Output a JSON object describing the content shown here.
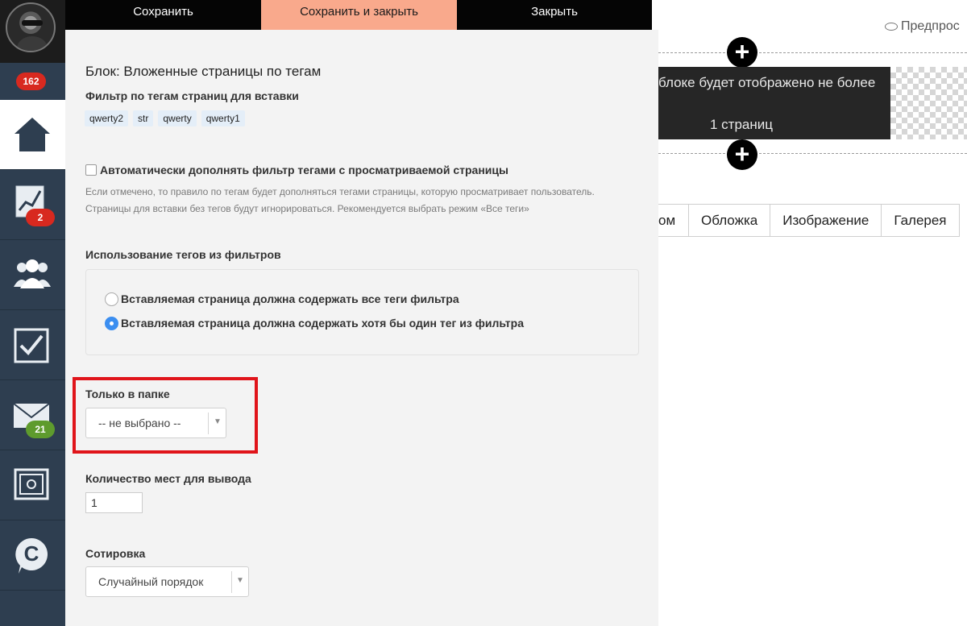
{
  "nav": {
    "badge_top": "162",
    "items": [
      {
        "name": "home",
        "badge": ""
      },
      {
        "name": "stats",
        "badge": "2"
      },
      {
        "name": "users",
        "badge": ""
      },
      {
        "name": "tasks",
        "badge": ""
      },
      {
        "name": "mail",
        "badge": "21"
      },
      {
        "name": "safe",
        "badge": ""
      },
      {
        "name": "support",
        "badge": ""
      }
    ]
  },
  "toolbar": {
    "save_label": "Сохранить",
    "save_close_label": "Сохранить и закрыть",
    "close_label": "Закрыть"
  },
  "form": {
    "title": "Блок: Вложенные страницы по тегам",
    "filter_label": "Фильтр по тегам страниц для вставки",
    "tags": [
      "qwerty2",
      "str",
      "qwerty",
      "qwerty1"
    ],
    "auto_fill_label": "Автоматически дополнять фильтр тегами с просматриваемой страницы",
    "auto_fill_help_1": "Если отмечено, то правило по тегам будет дополняться тегами страницы, которую просматривает пользователь.",
    "auto_fill_help_2": "Страницы для вставки без тегов будут игнорироваться. Рекомендуется выбрать режим «Все теги»",
    "tags_usage_label": "Использование тегов из фильтров",
    "radio_all": "Вставляемая страница должна содержать все теги фильтра",
    "radio_any": "Вставляемая страница должна содержать хотя бы один тег из фильтра",
    "folder_label": "Только в папке",
    "folder_value": "-- не выбрано --",
    "count_label": "Количество мест для вывода",
    "count_value": "1",
    "sort_label": "Сотировка",
    "sort_value": "Случайный порядок"
  },
  "preview": {
    "preview_label": "Предпрос",
    "block_text_line1": "блоке будет отображено не более",
    "block_text_line2": "1 страниц",
    "tabs": [
      "ом",
      "Обложка",
      "Изображение",
      "Галерея"
    ]
  },
  "colors": {
    "accent_button": "#f9a98c",
    "nav_bg": "#2e3e50",
    "highlight": "#e0141a",
    "badge_red": "#d8291f",
    "badge_green": "#5e9b2d",
    "radio_selected": "#3b8ef0"
  }
}
